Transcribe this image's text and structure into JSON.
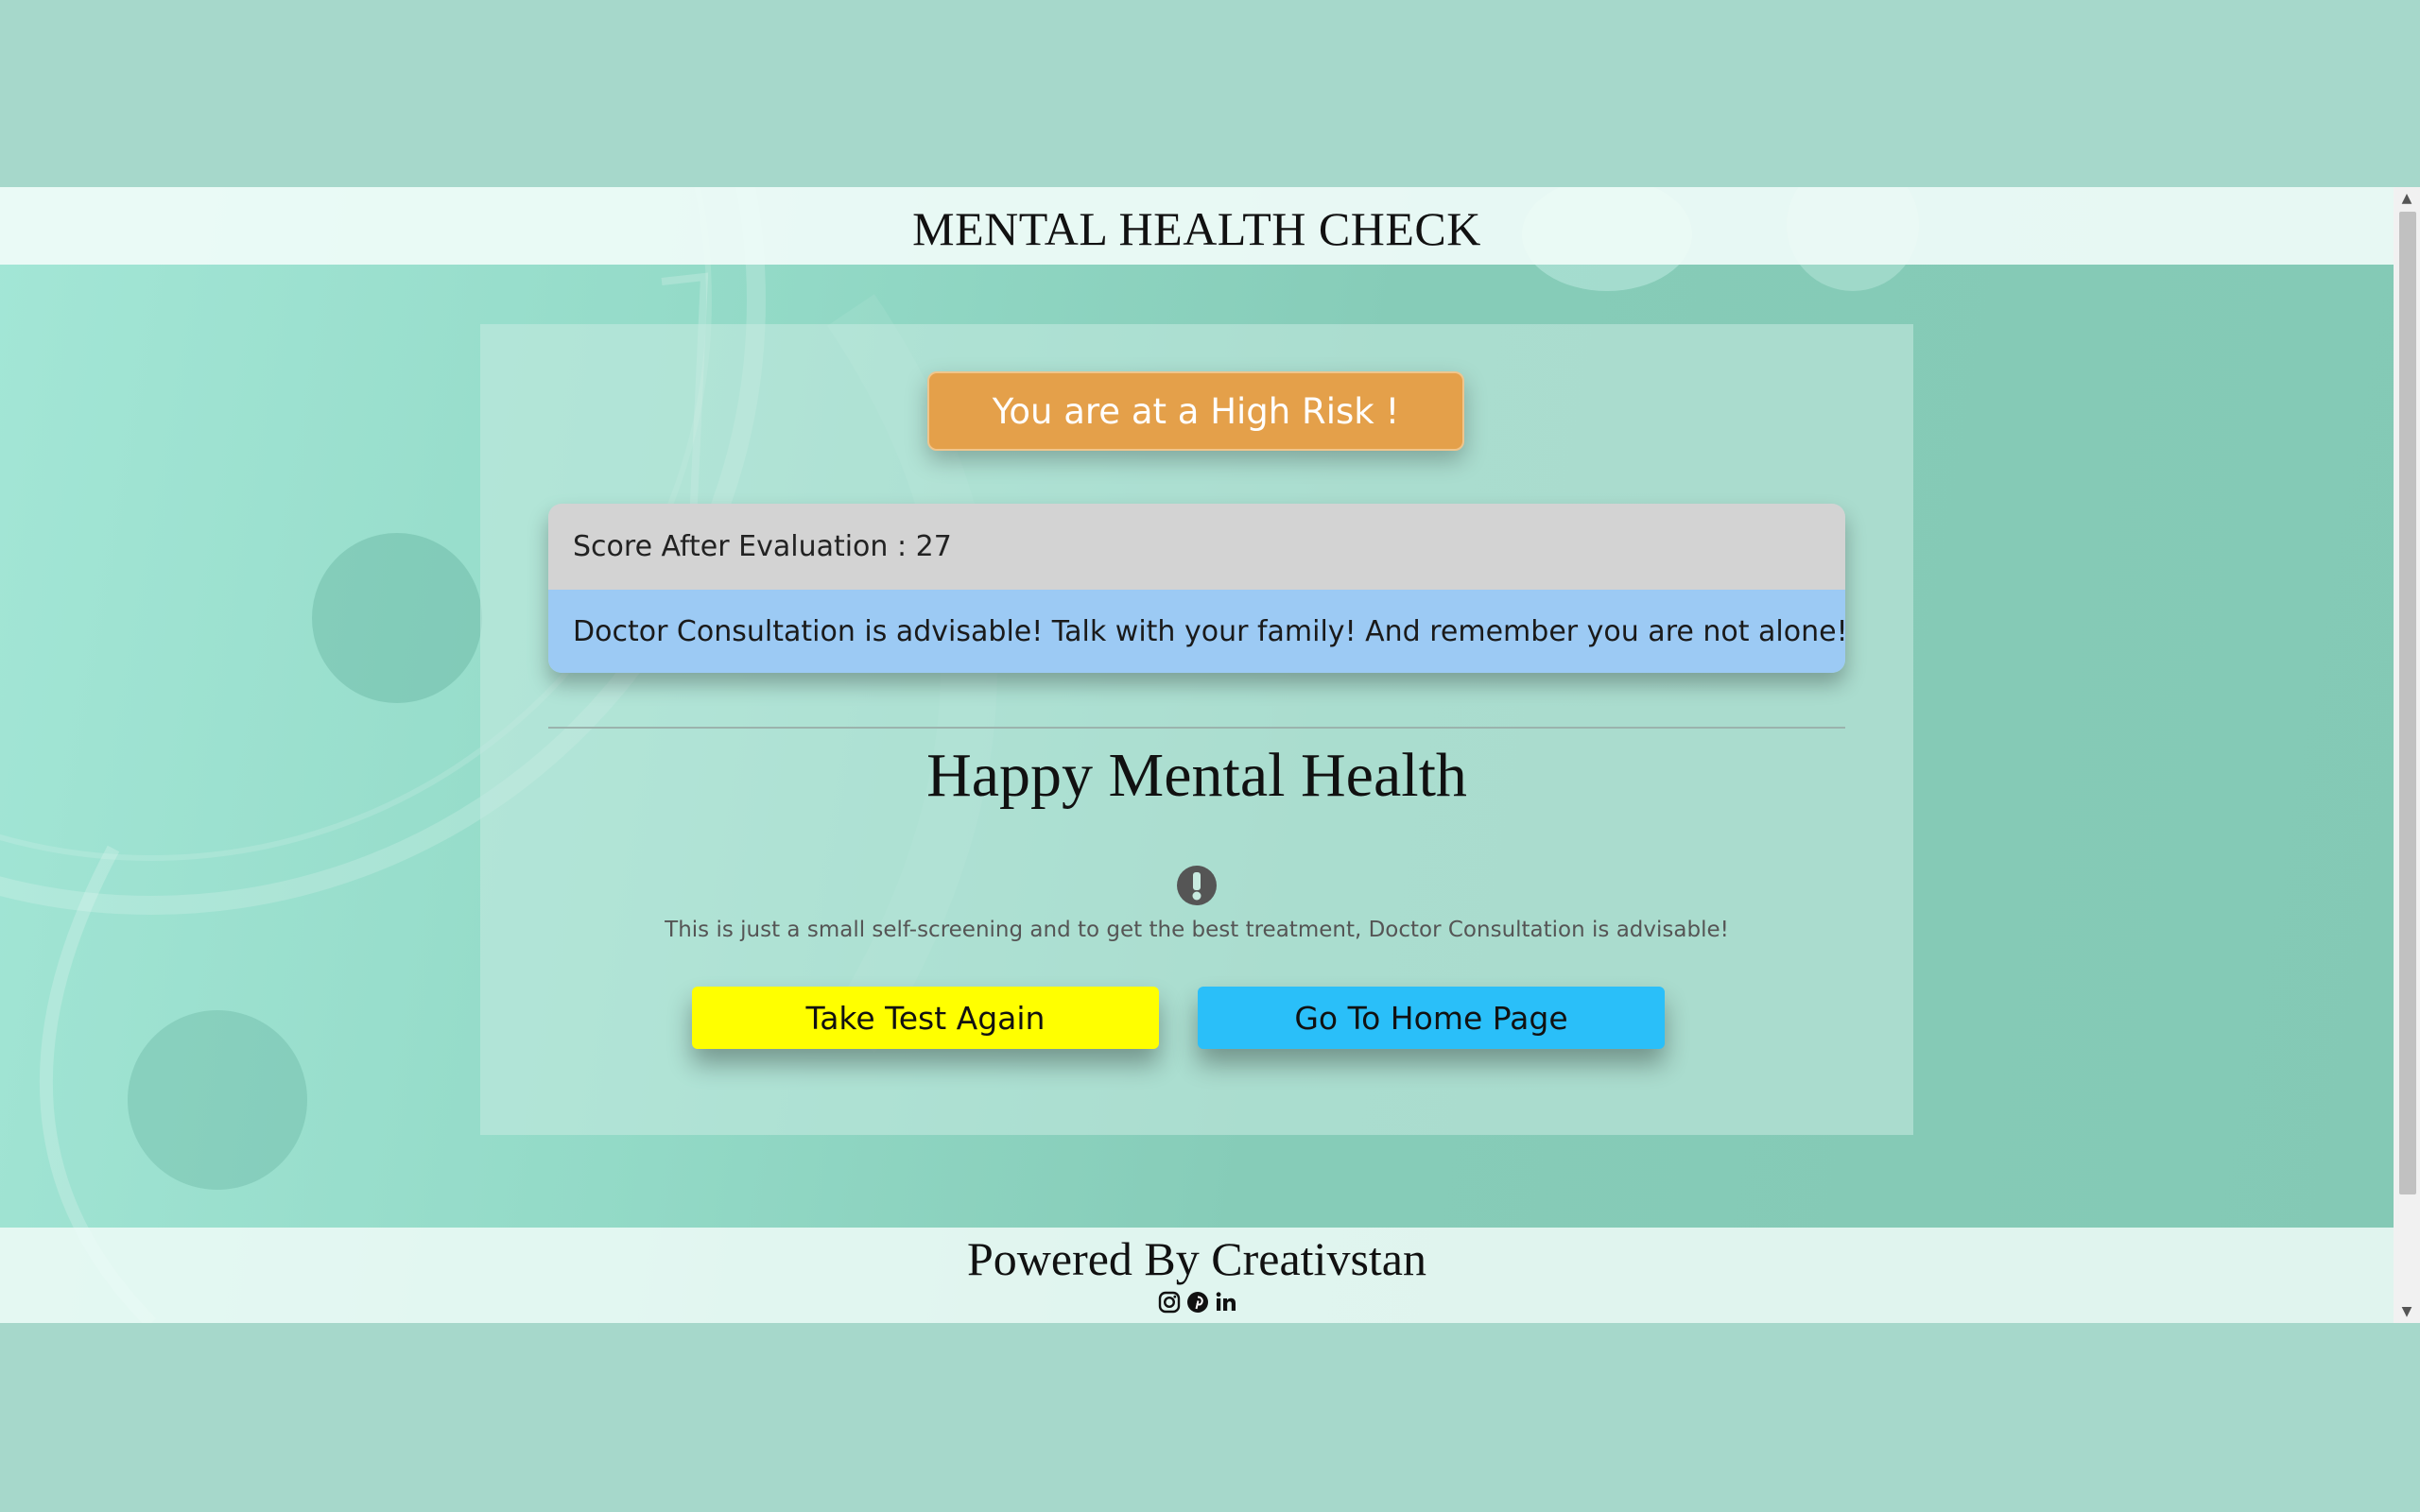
{
  "header": {
    "title": "MENTAL HEALTH CHECK"
  },
  "result": {
    "risk_label": "You are at a High Risk !",
    "score_text": "Score After Evaluation : 27",
    "advice_text": "Doctor Consultation is advisable! Talk with your family! And remember you are not alone!"
  },
  "section": {
    "title": "Happy Mental Health",
    "note": "This is just a small self-screening and to get the best treatment, Doctor Consultation is advisable!",
    "icon": "exclamation-circle-icon"
  },
  "buttons": {
    "take_test_again": "Take Test Again",
    "go_home": "Go To Home Page"
  },
  "footer": {
    "powered_by": "Powered By Creativstan",
    "social_icons": [
      "instagram-icon",
      "pinterest-icon",
      "linkedin-icon"
    ]
  },
  "colors": {
    "risk_badge": "#e4a04a",
    "score_row": "#d3d3d3",
    "advice_row": "#9ccaf4",
    "take_test_button": "#ffff00",
    "home_button": "#2abff9",
    "page_background": "#a6d8cb"
  }
}
